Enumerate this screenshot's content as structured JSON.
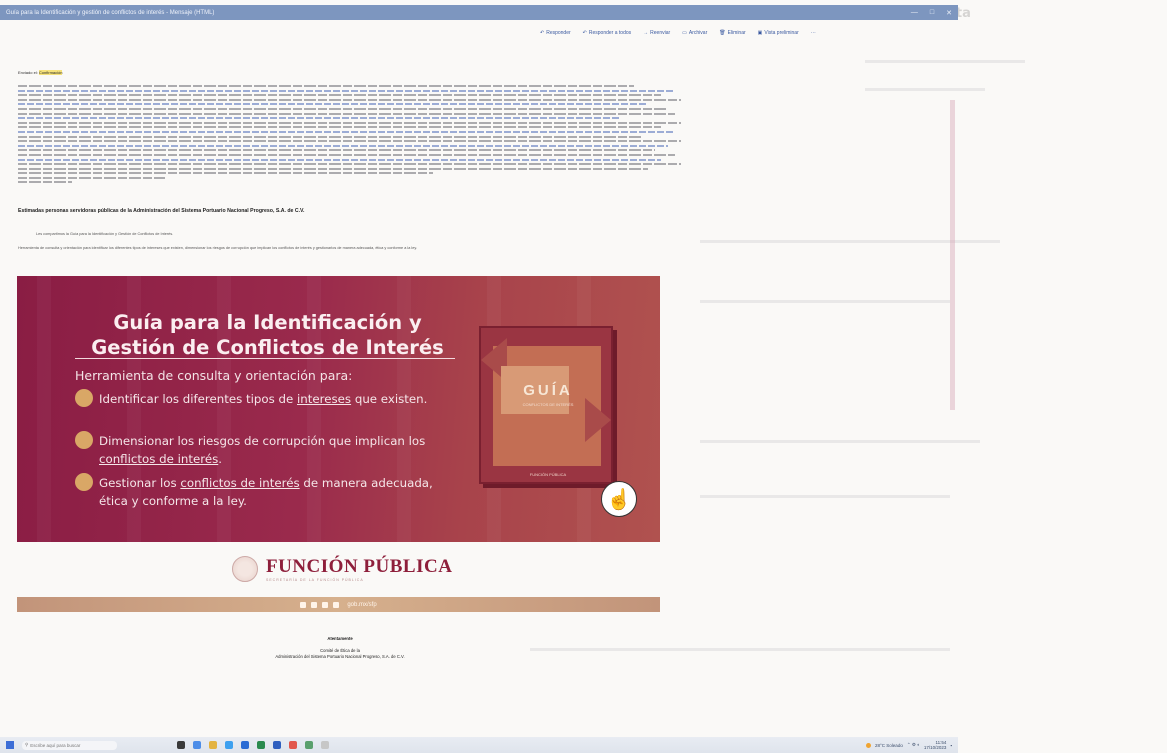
{
  "window": {
    "title": "Guía para la Identificación y gestión de conflictos de interés - Mensaje (HTML)",
    "controls": [
      "—",
      "□",
      "✕"
    ]
  },
  "toolbar": {
    "items": [
      {
        "label": "Responder",
        "icon": "reply-icon"
      },
      {
        "label": "Responder a todos",
        "icon": "reply-all-icon"
      },
      {
        "label": "Reenviar",
        "icon": "forward-icon"
      },
      {
        "label": "Archivar",
        "icon": "archive-icon"
      },
      {
        "label": "Eliminar",
        "icon": "delete-icon"
      },
      {
        "label": "Vista preliminar",
        "icon": "preview-icon"
      }
    ],
    "more": "···"
  },
  "email": {
    "meta_from": "Enviado el: ",
    "meta_highlight": "Confirmación",
    "greeting": "Estimadas personas servidoras públicas de la Administración del Sistema Portuario Nacional Progreso, S.A. de C.V.",
    "para1": "Les compartimos la Guía para la Identificación y Gestión de Conflictos de Interés.",
    "para2": "Herramienta de consulta y orientación para identificar los diferentes tipos de intereses que existen, dimensionar los riesgos de corrupción que implican los conflictos de interés y gestionarlos de manera adecuada, ética y conforme a la ley."
  },
  "banner": {
    "title": "Guía para la Identificación y Gestión de Conflictos de Interés",
    "subtitle": "Herramienta de consulta y orientación para:",
    "bullets": [
      {
        "pre": "Identificar los diferentes tipos de ",
        "link": "intereses",
        "post": " que existen."
      },
      {
        "pre": "Dimensionar los riesgos de corrupción que implican los ",
        "link": "conflictos de interés",
        "post": "."
      },
      {
        "pre": "Gestionar los ",
        "link": "conflictos de interés",
        "post": " de manera adecuada, ética y conforme a la ley."
      }
    ],
    "book": {
      "title": "GUÍA",
      "subtitle": "CONFLICTOS DE INTERÉS",
      "footer": "FUNCIÓN PÚBLICA"
    }
  },
  "brand": {
    "name": "FUNCIÓN PÚBLICA",
    "tagline": "SECRETARÍA DE LA FUNCIÓN PÚBLICA",
    "site": "gob.mx/sfp"
  },
  "closing": {
    "salutation": "Atentamente",
    "line1": "Comité de Ética de la",
    "line2": "Administración del Sistema Portuario Nacional Progreso, S.A. de C.V."
  },
  "taskbar": {
    "search_placeholder": "Escribe aquí para buscar",
    "weather": "28°C Soleado",
    "time": "11:54",
    "date": "17/10/2023"
  },
  "colors": {
    "banner": "#8a1d44",
    "accent_gold": "#d9a766",
    "brand": "#8e1f3b",
    "titlebar": "#7d96bf"
  }
}
